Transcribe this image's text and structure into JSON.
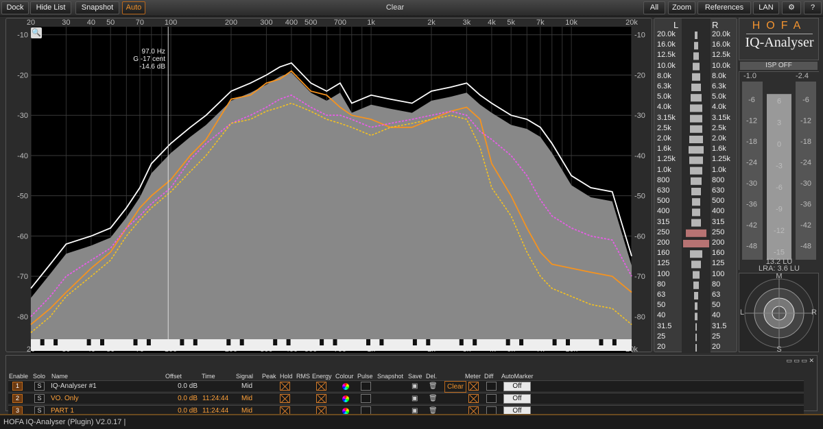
{
  "toolbar": {
    "dock": "Dock",
    "hide_list": "Hide List",
    "snapshot": "Snapshot",
    "auto": "Auto",
    "clear": "Clear",
    "all": "All",
    "zoom": "Zoom",
    "references": "References",
    "lan": "LAN",
    "help": "?"
  },
  "spectrum": {
    "freq_ticks": [
      "20",
      "30",
      "40",
      "50",
      "70",
      "100",
      "200",
      "300",
      "400",
      "500",
      "700",
      "1k",
      "2k",
      "3k",
      "4k",
      "5k",
      "7k",
      "10k",
      "20k"
    ],
    "db_ticks": [
      "-10",
      "-20",
      "-30",
      "-40",
      "-50",
      "-60",
      "-70",
      "-80"
    ],
    "cursor": {
      "freq": "97.0 Hz",
      "note": "G -17 cent",
      "level": "-14.6 dB"
    }
  },
  "chart_data": {
    "type": "line",
    "x_scale": "log",
    "xlim": [
      20,
      20000
    ],
    "ylim": [
      -87,
      -8
    ],
    "x": [
      20,
      25,
      30,
      40,
      50,
      60,
      70,
      80,
      100,
      125,
      150,
      200,
      250,
      300,
      350,
      400,
      500,
      600,
      700,
      800,
      1000,
      1250,
      1600,
      2000,
      2500,
      3000,
      3500,
      4000,
      5000,
      6000,
      7000,
      8000,
      10000,
      12500,
      16000,
      20000
    ],
    "series": [
      {
        "name": "Peak",
        "color": "#ffffff",
        "values": [
          -73,
          -67,
          -62,
          -60,
          -58,
          -53,
          -48,
          -42,
          -37,
          -33,
          -30,
          -24,
          -22,
          -20,
          -18,
          -17,
          -22,
          -24,
          -22,
          -27,
          -25,
          -26,
          -27,
          -24,
          -23,
          -22,
          -25,
          -27,
          -30,
          -31,
          -33,
          -37,
          -45,
          -48,
          -49,
          -65
        ]
      },
      {
        "name": "Snapshot",
        "color": "#f5931f",
        "values": [
          -82,
          -78,
          -74,
          -68,
          -64,
          -58,
          -53,
          -50,
          -46,
          -40,
          -36,
          -26,
          -25,
          -22,
          -21,
          -19,
          -24,
          -25,
          -28,
          -30,
          -31,
          -33,
          -33,
          -31,
          -29,
          -28,
          -31,
          -42,
          -50,
          -58,
          -64,
          -67,
          -68,
          -69,
          -70,
          -74
        ]
      },
      {
        "name": "VO. Only",
        "color": "#e85de8",
        "values": [
          -80,
          -75,
          -70,
          -66,
          -63,
          -58,
          -55,
          -52,
          -48,
          -41,
          -37,
          -32,
          -30,
          -28,
          -26,
          -25,
          -28,
          -30,
          -30,
          -31,
          -33,
          -32,
          -31,
          -30,
          -29,
          -30,
          -34,
          -36,
          -40,
          -45,
          -51,
          -55,
          -58,
          -60,
          -61,
          -70
        ]
      },
      {
        "name": "PART 1",
        "color": "#f5c21f",
        "values": [
          -84,
          -80,
          -75,
          -70,
          -66,
          -60,
          -56,
          -53,
          -49,
          -44,
          -40,
          -32,
          -31,
          -29,
          -28,
          -27,
          -29,
          -31,
          -32,
          -33,
          -35,
          -33,
          -32,
          -31,
          -30,
          -31,
          -38,
          -48,
          -55,
          -64,
          -70,
          -73,
          -75,
          -77,
          -78,
          -82
        ]
      }
    ]
  },
  "lr_meter": {
    "left": "L",
    "right": "R",
    "bands": [
      "20.0k",
      "16.0k",
      "12.5k",
      "10.0k",
      "8.0k",
      "6.3k",
      "5.0k",
      "4.0k",
      "3.15k",
      "2.5k",
      "2.0k",
      "1.6k",
      "1.25k",
      "1.0k",
      "800",
      "630",
      "500",
      "400",
      "315",
      "250",
      "200",
      "160",
      "125",
      "100",
      "80",
      "63",
      "50",
      "40",
      "31.5",
      "25",
      "20"
    ]
  },
  "brand": {
    "name": "HOFA",
    "model": "IQ-Analyser"
  },
  "loudness": {
    "isp": "ISP OFF",
    "left_peak": "-1.0",
    "right_peak": "-2.4",
    "scale": [
      "-6",
      "-12",
      "-18",
      "-24",
      "-30",
      "-36",
      "-42",
      "-48"
    ],
    "center_scale": [
      "6",
      "3",
      "0",
      "-3",
      "-6",
      "-9",
      "-12",
      "-15"
    ],
    "lu": "13.2 LU",
    "lra": "LRA: 3.6 LU",
    "bar_level": 0.93
  },
  "radar": {
    "m": "M",
    "s": "S",
    "l": "L",
    "r": "R"
  },
  "tracks": {
    "headers": [
      "Enable",
      "Solo",
      "Name",
      "Offset",
      "Time",
      "Signal",
      "Peak",
      "Hold",
      "RMS",
      "Energy",
      "Colour",
      "Pulse",
      "Snapshot",
      "Save",
      "Del.",
      "Meter",
      "Diff",
      "AutoMarker"
    ],
    "rows": [
      {
        "num": "1",
        "solo": "S",
        "name": "IQ-Analyser #1",
        "offset": "0.0 dB",
        "time": "",
        "signal": "Mid",
        "clear": "Clear",
        "auto": "Off"
      },
      {
        "num": "2",
        "solo": "S",
        "name": "VO. Only",
        "offset": "0.0 dB",
        "time": "11:24:44",
        "signal": "Mid",
        "auto": "Off"
      },
      {
        "num": "3",
        "solo": "S",
        "name": "PART 1",
        "offset": "0.0 dB",
        "time": "11:24:44",
        "signal": "Mid",
        "auto": "Off"
      }
    ]
  },
  "status": "HOFA IQ-Analyser (Plugin) V2.0.17  |"
}
